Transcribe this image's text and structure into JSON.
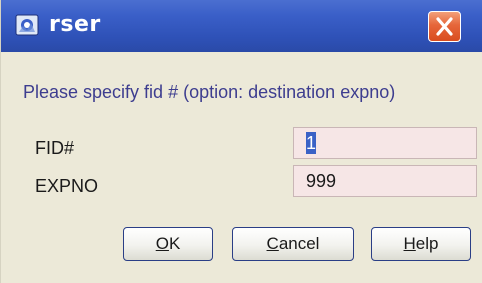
{
  "window": {
    "title": "rser",
    "icon": "bruker-app-icon",
    "close_icon": "close-icon"
  },
  "prompt": "Please specify fid # (option: destination expno)",
  "fields": [
    {
      "label": "FID#",
      "value": "1",
      "selected": true
    },
    {
      "label": "EXPNO",
      "value": "999",
      "selected": false
    }
  ],
  "buttons": {
    "ok": {
      "mnemonic": "O",
      "rest": "K"
    },
    "cancel": {
      "mnemonic": "C",
      "rest": "ancel"
    },
    "help": {
      "mnemonic": "H",
      "rest": "elp"
    }
  },
  "colors": {
    "title_bar": "#2f52b8",
    "prompt_text": "#3d3d8f",
    "input_bg": "#f6e6e6",
    "selection": "#3a62c6",
    "close_button": "#e6663a"
  }
}
